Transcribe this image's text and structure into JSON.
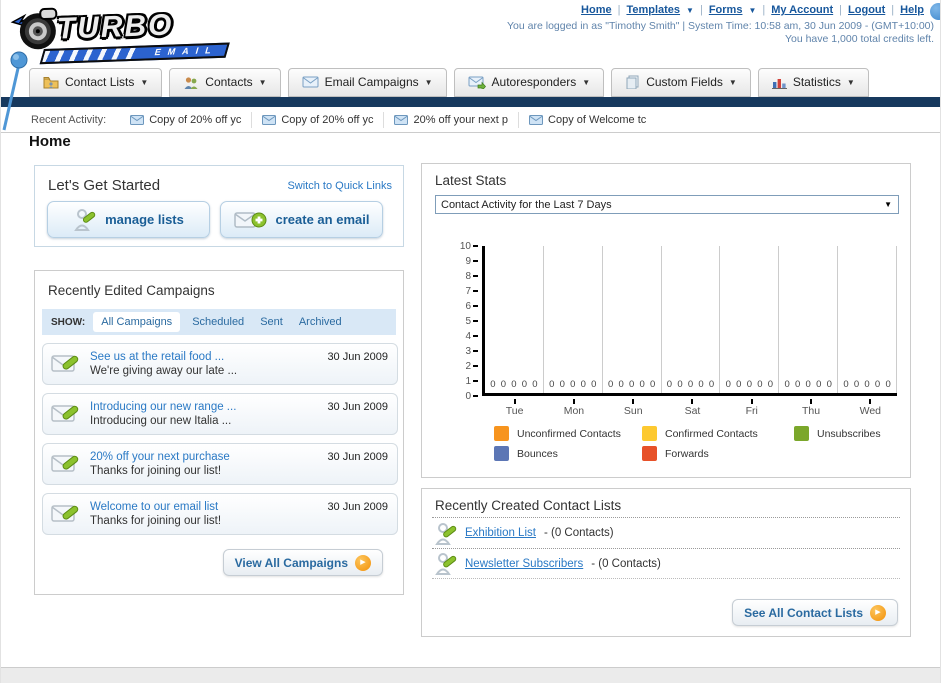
{
  "header": {
    "logo": {
      "turbo": "TURBO",
      "email": "EMAIL"
    },
    "links": [
      "Home",
      "Templates",
      "Forms",
      "My Account",
      "Logout",
      "Help"
    ],
    "login_line": "You are logged in as \"Timothy Smith\" | System Time: 10:58 am, 30 Jun 2009 - (GMT+10:00)",
    "credits_line": "You have 1,000 total credits left."
  },
  "nav": {
    "tabs": [
      {
        "label": "Contact Lists"
      },
      {
        "label": "Contacts"
      },
      {
        "label": "Email Campaigns"
      },
      {
        "label": "Autoresponders"
      },
      {
        "label": "Custom Fields"
      },
      {
        "label": "Statistics"
      }
    ]
  },
  "recent_activity": {
    "label": "Recent Activity:",
    "items": [
      "Copy of 20% off yc",
      "Copy of 20% off yc",
      "20% off your next p",
      "Copy of Welcome tc"
    ]
  },
  "page": {
    "title": "Home"
  },
  "get_started": {
    "title": "Let's Get Started",
    "switch_link": "Switch to Quick Links",
    "manage_lists_label": "manage lists",
    "create_email_label": "create an email"
  },
  "campaigns": {
    "title": "Recently Edited Campaigns",
    "show_label": "SHOW:",
    "filters": [
      "All Campaigns",
      "Scheduled",
      "Sent",
      "Archived"
    ],
    "active_filter": "All Campaigns",
    "items": [
      {
        "title": "See us at the retail food ...",
        "subtitle": "We're giving away our late ...",
        "date": "30 Jun 2009"
      },
      {
        "title": "Introducing our new range ...",
        "subtitle": "Introducing our new Italia ...",
        "date": "30 Jun 2009"
      },
      {
        "title": "20% off your next purchase",
        "subtitle": "Thanks for joining our list!",
        "date": "30 Jun 2009"
      },
      {
        "title": "Welcome to our email list",
        "subtitle": "Thanks for joining our list!",
        "date": "30 Jun 2009"
      }
    ],
    "view_all_label": "View All Campaigns"
  },
  "latest_stats": {
    "title": "Latest Stats",
    "dropdown_value": "Contact Activity for the Last 7 Days"
  },
  "chart_data": {
    "type": "bar",
    "title": "Contact Activity for the Last 7 Days",
    "categories": [
      "Tue",
      "Mon",
      "Sun",
      "Sat",
      "Fri",
      "Thu",
      "Wed"
    ],
    "series": [
      {
        "name": "Unconfirmed Contacts",
        "color": "#F7941E",
        "values": [
          0,
          0,
          0,
          0,
          0,
          0,
          0
        ]
      },
      {
        "name": "Confirmed Contacts",
        "color": "#FDC930",
        "values": [
          0,
          0,
          0,
          0,
          0,
          0,
          0
        ]
      },
      {
        "name": "Unsubscribes",
        "color": "#7BA72B",
        "values": [
          0,
          0,
          0,
          0,
          0,
          0,
          0
        ]
      },
      {
        "name": "Bounces",
        "color": "#5C76B5",
        "values": [
          0,
          0,
          0,
          0,
          0,
          0,
          0
        ]
      },
      {
        "name": "Forwards",
        "color": "#E75129",
        "values": [
          0,
          0,
          0,
          0,
          0,
          0,
          0
        ]
      }
    ],
    "ylim": [
      0,
      10
    ],
    "ytick_step": 1,
    "grid": "vertical-day-separators",
    "legend_position": "bottom",
    "value_labels": "each series value shown as 0 above x-axis"
  },
  "contact_lists": {
    "title": "Recently Created Contact Lists",
    "items": [
      {
        "name": "Exhibition List",
        "count_text": "- (0 Contacts)"
      },
      {
        "name": "Newsletter Subscribers",
        "count_text": "- (0 Contacts)"
      }
    ],
    "see_all_label": "See All Contact Lists"
  },
  "colors": {
    "navy_bar": "#17395E",
    "link_blue": "#2A79C5",
    "accent_orange": "#F29008",
    "panel_highlight_blue": "#D9E8F6"
  }
}
